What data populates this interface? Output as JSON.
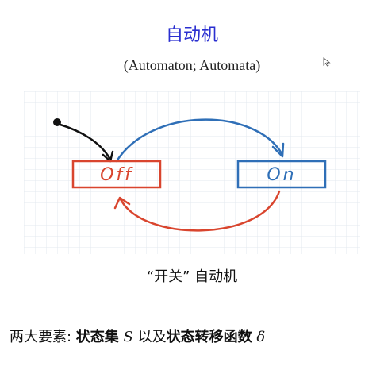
{
  "title": "自动机",
  "subtitle": "(Automaton; Automata)",
  "diagram": {
    "state_off": "Off",
    "state_on": "On",
    "colors": {
      "off": "#d9452e",
      "on": "#2f6fb7",
      "start": "#111111",
      "grid": "#e3e9ef"
    }
  },
  "caption": "“开关” 自动机",
  "bottom": {
    "prefix": "两大要素: ",
    "states_label": "状态集",
    "states_symbol": "S",
    "connector": "以及",
    "transition_label": "状态转移函数",
    "transition_symbol": "δ"
  }
}
